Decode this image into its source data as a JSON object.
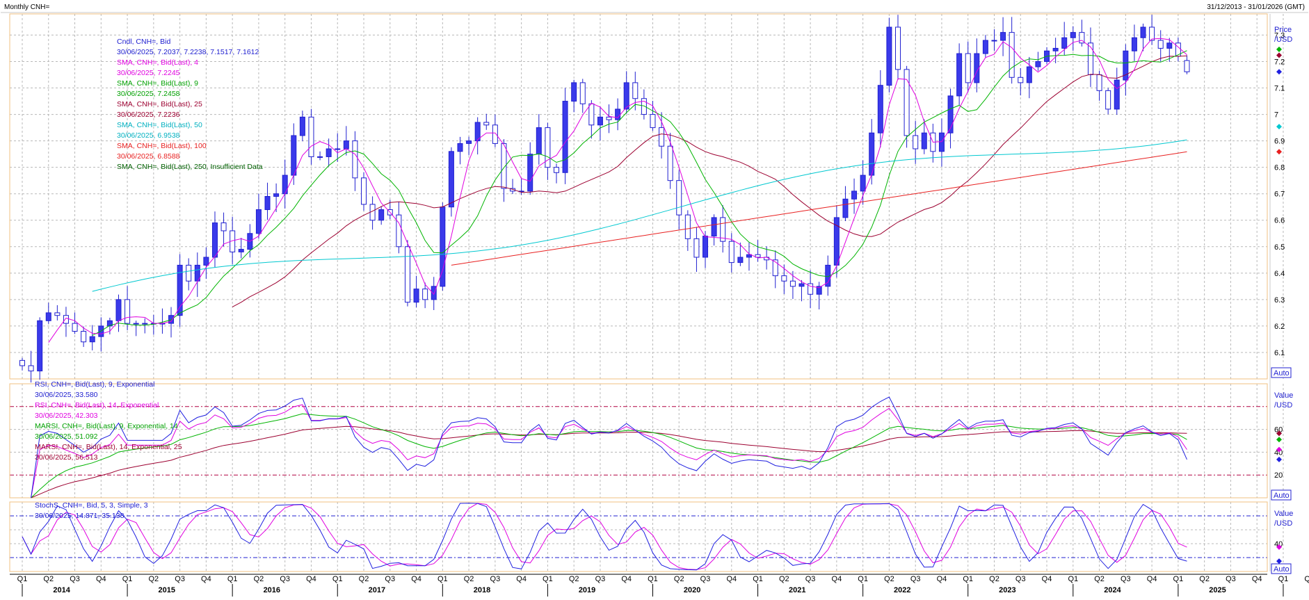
{
  "header": {
    "title": "Monthly CNH=",
    "range": "31/12/2013 - 31/01/2026 (GMT)"
  },
  "colors": {
    "candle_up_fill": "#ffffff",
    "candle_down_fill": "#3a3aea",
    "candle_outline": "#2020d0",
    "sma4": "#e000e0",
    "sma9": "#00b400",
    "sma25": "#9c0030",
    "sma50": "#00c8d0",
    "sma100": "#e82020",
    "rsi9": "#2020e0",
    "rsi14": "#e000e0",
    "marsi9": "#00b400",
    "marsi14": "#9c0030",
    "stoch_k": "#2020e0",
    "stoch_d": "#e000e0",
    "grid": "#b8b8b8",
    "panel_border": "#f0c080",
    "ref_line": "#b00040"
  },
  "panels": {
    "price": {
      "axis_title_1": "Price",
      "axis_title_2": "/USD",
      "auto_label": "Auto",
      "legend": [
        {
          "text": "Cndl, CNH=, Bid",
          "color": "#2020d0"
        },
        {
          "text": "30/06/2025, 7.2037, 7.2238, 7.1517, 7.1612",
          "color": "#2020d0"
        },
        {
          "text": "SMA, CNH=, Bid(Last), 4",
          "color": "#e000e0"
        },
        {
          "text": "30/06/2025, 7.2245",
          "color": "#e000e0"
        },
        {
          "text": "SMA, CNH=, Bid(Last), 9",
          "color": "#00a000"
        },
        {
          "text": "30/06/2025, 7.2458",
          "color": "#00a000"
        },
        {
          "text": "SMA, CNH=, Bid(Last), 25",
          "color": "#9c0030"
        },
        {
          "text": "30/06/2025, 7.2236",
          "color": "#9c0030"
        },
        {
          "text": "SMA, CNH=, Bid(Last), 50",
          "color": "#00b0c0"
        },
        {
          "text": "30/06/2025, 6.9538",
          "color": "#00b0c0"
        },
        {
          "text": "SMA, CNH=, Bid(Last), 100",
          "color": "#e82020"
        },
        {
          "text": "30/06/2025, 6.8588",
          "color": "#e82020"
        },
        {
          "text": "SMA, CNH=, Bid(Last), 250, Insufficient Data",
          "color": "#006000"
        }
      ]
    },
    "rsi": {
      "axis_title_1": "Value",
      "axis_title_2": "/USD",
      "auto_label": "Auto",
      "legend": [
        {
          "text": "RSI, CNH=, Bid(Last), 9, Exponential",
          "color": "#2020d0"
        },
        {
          "text": "30/06/2025, 33.580",
          "color": "#2020d0"
        },
        {
          "text": "RSI, CNH=, Bid(Last), 14, Exponential",
          "color": "#e000e0"
        },
        {
          "text": "30/06/2025, 42.303",
          "color": "#e000e0"
        },
        {
          "text": "MARSI, CNH=, Bid(Last), 9, Exponential, 14",
          "color": "#00a000"
        },
        {
          "text": "30/06/2025, 51.092",
          "color": "#00a000"
        },
        {
          "text": "MARSI, CNH=, Bid(Last), 14, Exponential, 25",
          "color": "#9c0030"
        },
        {
          "text": "30/06/2025, 56.513",
          "color": "#9c0030"
        }
      ]
    },
    "stoch": {
      "axis_title_1": "Value",
      "axis_title_2": "/USD",
      "auto_label": "Auto",
      "legend": [
        {
          "text": "StochS, CNH=, Bid, 5, 3, Simple, 3",
          "color": "#2020d0"
        },
        {
          "text": "30/06/2025, 14.871, 35.138",
          "color": "#2020d0"
        }
      ]
    }
  },
  "chart_data": {
    "type": "line",
    "subtype": "candlestick",
    "timeframe": "monthly",
    "x_start_quarter": "2014 Q1",
    "x_axis": {
      "quarter_labels": [
        "Q1",
        "Q2",
        "Q3",
        "Q4",
        "Q1",
        "Q2",
        "Q3",
        "Q4",
        "Q1",
        "Q2",
        "Q3",
        "Q4",
        "Q1",
        "Q2",
        "Q3",
        "Q4",
        "Q1",
        "Q2",
        "Q3",
        "Q4",
        "Q1",
        "Q2",
        "Q3",
        "Q4",
        "Q1",
        "Q2",
        "Q3",
        "Q4",
        "Q1",
        "Q2",
        "Q3",
        "Q4",
        "Q1",
        "Q2",
        "Q3",
        "Q4",
        "Q1",
        "Q2",
        "Q3",
        "Q4",
        "Q1",
        "Q2",
        "Q3",
        "Q4",
        "Q1",
        "Q2",
        "Q3",
        "Q4",
        "Q1",
        "Q2",
        "Q3",
        "Q4",
        "Q1"
      ],
      "year_labels": [
        "2014",
        "2015",
        "2016",
        "2017",
        "2018",
        "2019",
        "2020",
        "2021",
        "2022",
        "2023",
        "2024",
        "2025"
      ]
    },
    "price": {
      "ylim": [
        6.0,
        7.38
      ],
      "yticks": [
        6.1,
        6.2,
        6.3,
        6.4,
        6.5,
        6.6,
        6.7,
        6.8,
        6.9,
        7.0,
        7.1,
        7.2,
        7.3
      ],
      "ytick_labels": [
        "6.1",
        "6.2",
        "6.3",
        "6.4",
        "6.5",
        "6.6",
        "6.7",
        "6.8",
        "6.9",
        "7",
        "7.1",
        "7.2",
        "7.3"
      ],
      "candles_close": [
        6.05,
        6.03,
        6.22,
        6.25,
        6.24,
        6.21,
        6.18,
        6.14,
        6.16,
        6.2,
        6.22,
        6.3,
        6.21,
        6.21,
        6.21,
        6.21,
        6.21,
        6.24,
        6.43,
        6.37,
        6.43,
        6.46,
        6.59,
        6.56,
        6.48,
        6.49,
        6.55,
        6.64,
        6.69,
        6.7,
        6.77,
        6.92,
        6.99,
        6.84,
        6.84,
        6.87,
        6.87,
        6.9,
        6.76,
        6.66,
        6.6,
        6.64,
        6.62,
        6.5,
        6.29,
        6.34,
        6.3,
        6.35,
        6.65,
        6.86,
        6.89,
        6.9,
        6.97,
        6.96,
        6.89,
        6.72,
        6.71,
        6.71,
        6.85,
        6.95,
        6.8,
        6.78,
        7.05,
        7.12,
        7.04,
        6.96,
        6.99,
        6.98,
        7.02,
        7.12,
        7.06,
        7.0,
        6.95,
        6.88,
        6.75,
        6.62,
        6.53,
        6.46,
        6.54,
        6.61,
        6.52,
        6.44,
        6.46,
        6.47,
        6.46,
        6.45,
        6.39,
        6.37,
        6.35,
        6.36,
        6.32,
        6.35,
        6.43,
        6.61,
        6.68,
        6.71,
        6.77,
        6.93,
        7.11,
        7.33,
        7.17,
        6.92,
        6.87,
        6.93,
        6.86,
        6.93,
        7.07,
        7.23,
        7.12,
        7.23,
        7.28,
        7.28,
        7.31,
        7.14,
        7.12,
        7.18,
        7.2,
        7.24,
        7.25,
        7.29,
        7.31,
        7.27,
        7.15,
        7.09,
        7.02,
        7.13,
        7.24,
        7.29,
        7.33,
        7.28,
        7.25,
        7.27,
        7.22,
        7.16
      ],
      "candle_open_2025_06": 7.2037,
      "candle_high_2025_06": 7.2238,
      "candle_low_2025_06": 7.1517,
      "candle_close_2025_06": 7.1612,
      "sma4_last": 7.2245,
      "sma9_last": 7.2458,
      "sma25_last": 7.2236,
      "sma50_last": 6.9538,
      "sma100_last": 6.8588
    },
    "rsi": {
      "ylim": [
        0,
        100
      ],
      "ref_levels": [
        80,
        20
      ],
      "yticks": [
        20,
        40,
        60
      ],
      "ytick_labels": [
        "20",
        "40",
        "60"
      ],
      "rsi9_last": 33.58,
      "rsi14_last": 42.303,
      "marsi9_last": 51.092,
      "marsi14_last": 56.513
    },
    "stoch": {
      "ylim": [
        0,
        100
      ],
      "ref_levels": [
        80,
        20
      ],
      "yticks": [
        40
      ],
      "ytick_labels": [
        "40"
      ],
      "k_last": 14.871,
      "d_last": 35.138
    }
  }
}
